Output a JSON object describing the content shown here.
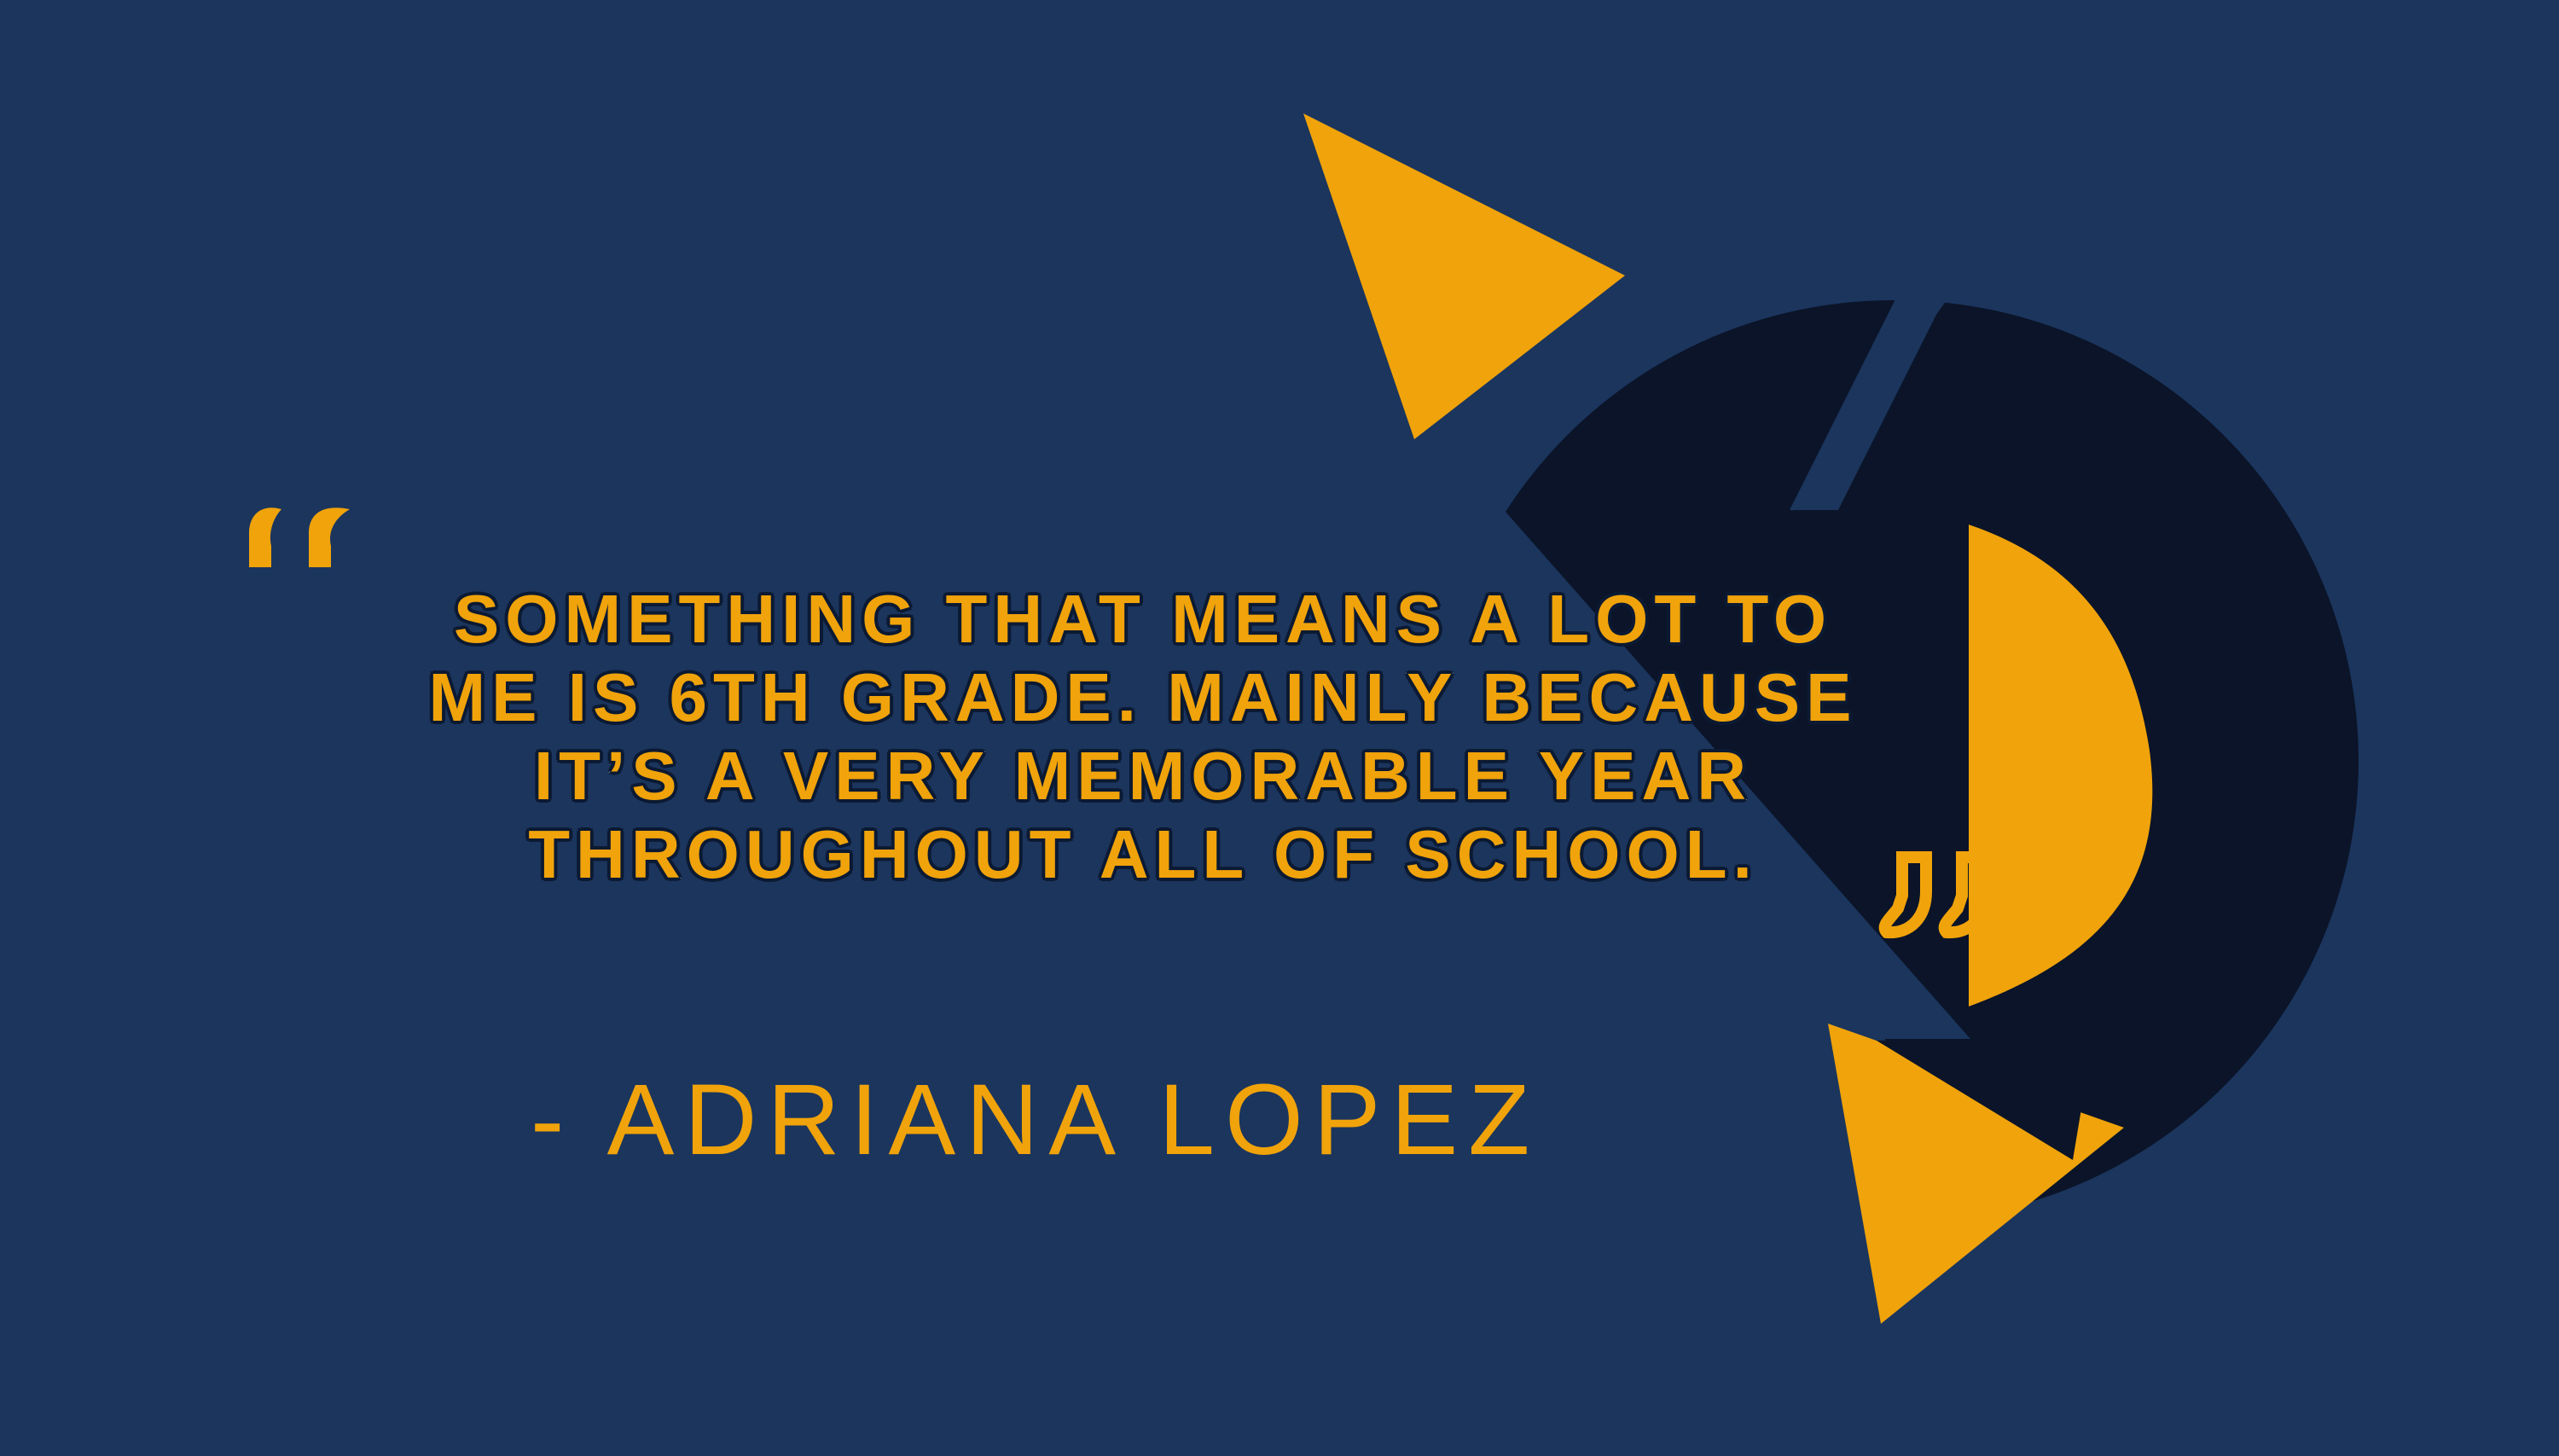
{
  "quote": {
    "lines": [
      "SOMETHING THAT MEANS A LOT TO",
      "ME IS 6TH GRADE. MAINLY BECAUSE",
      "IT’S A VERY MEMORABLE YEAR",
      "THROUGHOUT ALL OF SCHOOL."
    ],
    "attribution": "- ADRIANA LOPEZ"
  },
  "icons": {
    "open_quote": "open-quote-icon",
    "close_quote": "close-quote-icon"
  },
  "colors": {
    "background": "#1b355d",
    "accent": "#f0a30a",
    "dark_shape": "#0b1428",
    "text_outline": "#8f9aab"
  }
}
